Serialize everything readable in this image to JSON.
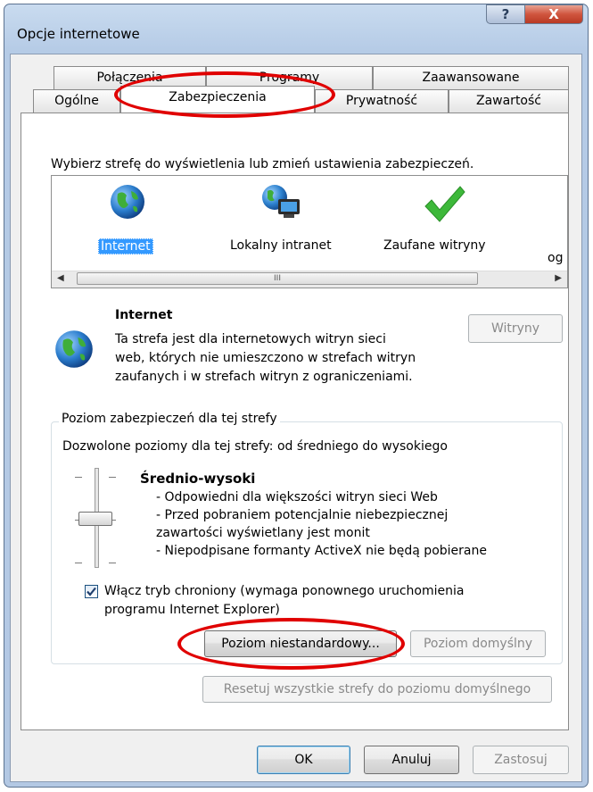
{
  "window": {
    "title": "Opcje internetowe",
    "help_glyph": "?",
    "close_glyph": "X"
  },
  "tabs": {
    "row1": [
      "Połączenia",
      "Programy",
      "Zaawansowane"
    ],
    "row2": [
      "Ogólne",
      "Zabezpieczenia",
      "Prywatność",
      "Zawartość"
    ],
    "selected": "Zabezpieczenia"
  },
  "zone_select": {
    "instruction": "Wybierz strefę do wyświetlenia lub zmień ustawienia zabezpieczeń.",
    "zones": [
      {
        "label": "Internet",
        "icon": "globe-icon",
        "selected": true
      },
      {
        "label": "Lokalny intranet",
        "icon": "intranet-icon",
        "selected": false
      },
      {
        "label": "Zaufane witryny",
        "icon": "checkmark-icon",
        "selected": false
      },
      {
        "label": "og",
        "icon": "",
        "selected": false
      }
    ],
    "scroll_thumb_glyph": "III"
  },
  "zone_info": {
    "name": "Internet",
    "description_lines": [
      "Ta strefa jest dla internetowych witryn sieci",
      "web, których nie umieszczono w strefach witryn",
      "zaufanych i w strefach witryn z ograniczeniami."
    ],
    "sites_button": "Witryny"
  },
  "security_level": {
    "group_label": "Poziom zabezpieczeń dla tej strefy",
    "allowed": "Dozwolone poziomy dla tej strefy: od średniego do wysokiego",
    "level_name": "Średnio-wysoki",
    "bullets": [
      "- Odpowiedni dla większości witryn sieci Web",
      "- Przed pobraniem potencjalnie niebezpiecznej",
      "zawartości wyświetlany jest monit",
      "- Niepodpisane formanty ActiveX nie będą pobierane"
    ],
    "protected_mode_line1": "Włącz tryb chroniony (wymaga ponownego uruchomienia",
    "protected_mode_line2": "programu Internet Explorer)",
    "protected_mode_checked": true,
    "custom_level_button": "Poziom niestandardowy...",
    "default_level_button": "Poziom domyślny",
    "reset_all_button": "Resetuj wszystkie strefy do poziomu domyślnego"
  },
  "footer": {
    "ok": "OK",
    "cancel": "Anuluj",
    "apply": "Zastosuj"
  },
  "colors": {
    "highlight_oval": "#e00000",
    "selection": "#3399ff"
  }
}
